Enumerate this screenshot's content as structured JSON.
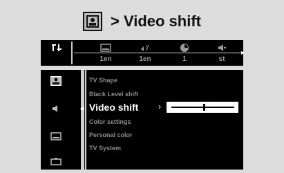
{
  "header": {
    "title": "> Video shift"
  },
  "topbar": {
    "cells": [
      {
        "icon": "settings-tools-icon",
        "value": ""
      },
      {
        "icon": "subtitle-icon",
        "value": "1en"
      },
      {
        "icon": "audio-language-icon",
        "value": "1en"
      },
      {
        "icon": "angle-icon",
        "value": "1"
      },
      {
        "icon": "sound-mode-icon",
        "value": "st"
      }
    ]
  },
  "sidebar": {
    "items": [
      {
        "icon": "picture-icon"
      },
      {
        "icon": "speaker-icon"
      },
      {
        "icon": "display-icon"
      },
      {
        "icon": "briefcase-icon"
      }
    ]
  },
  "menu": {
    "items": [
      {
        "label": "TV Shape"
      },
      {
        "label": "Black Level shift"
      },
      {
        "label": "Video shift"
      },
      {
        "label": "Color settings"
      },
      {
        "label": "Personal color"
      },
      {
        "label": "TV System"
      }
    ],
    "active_index": 2
  },
  "slider": {
    "value_fraction": 0.5
  }
}
